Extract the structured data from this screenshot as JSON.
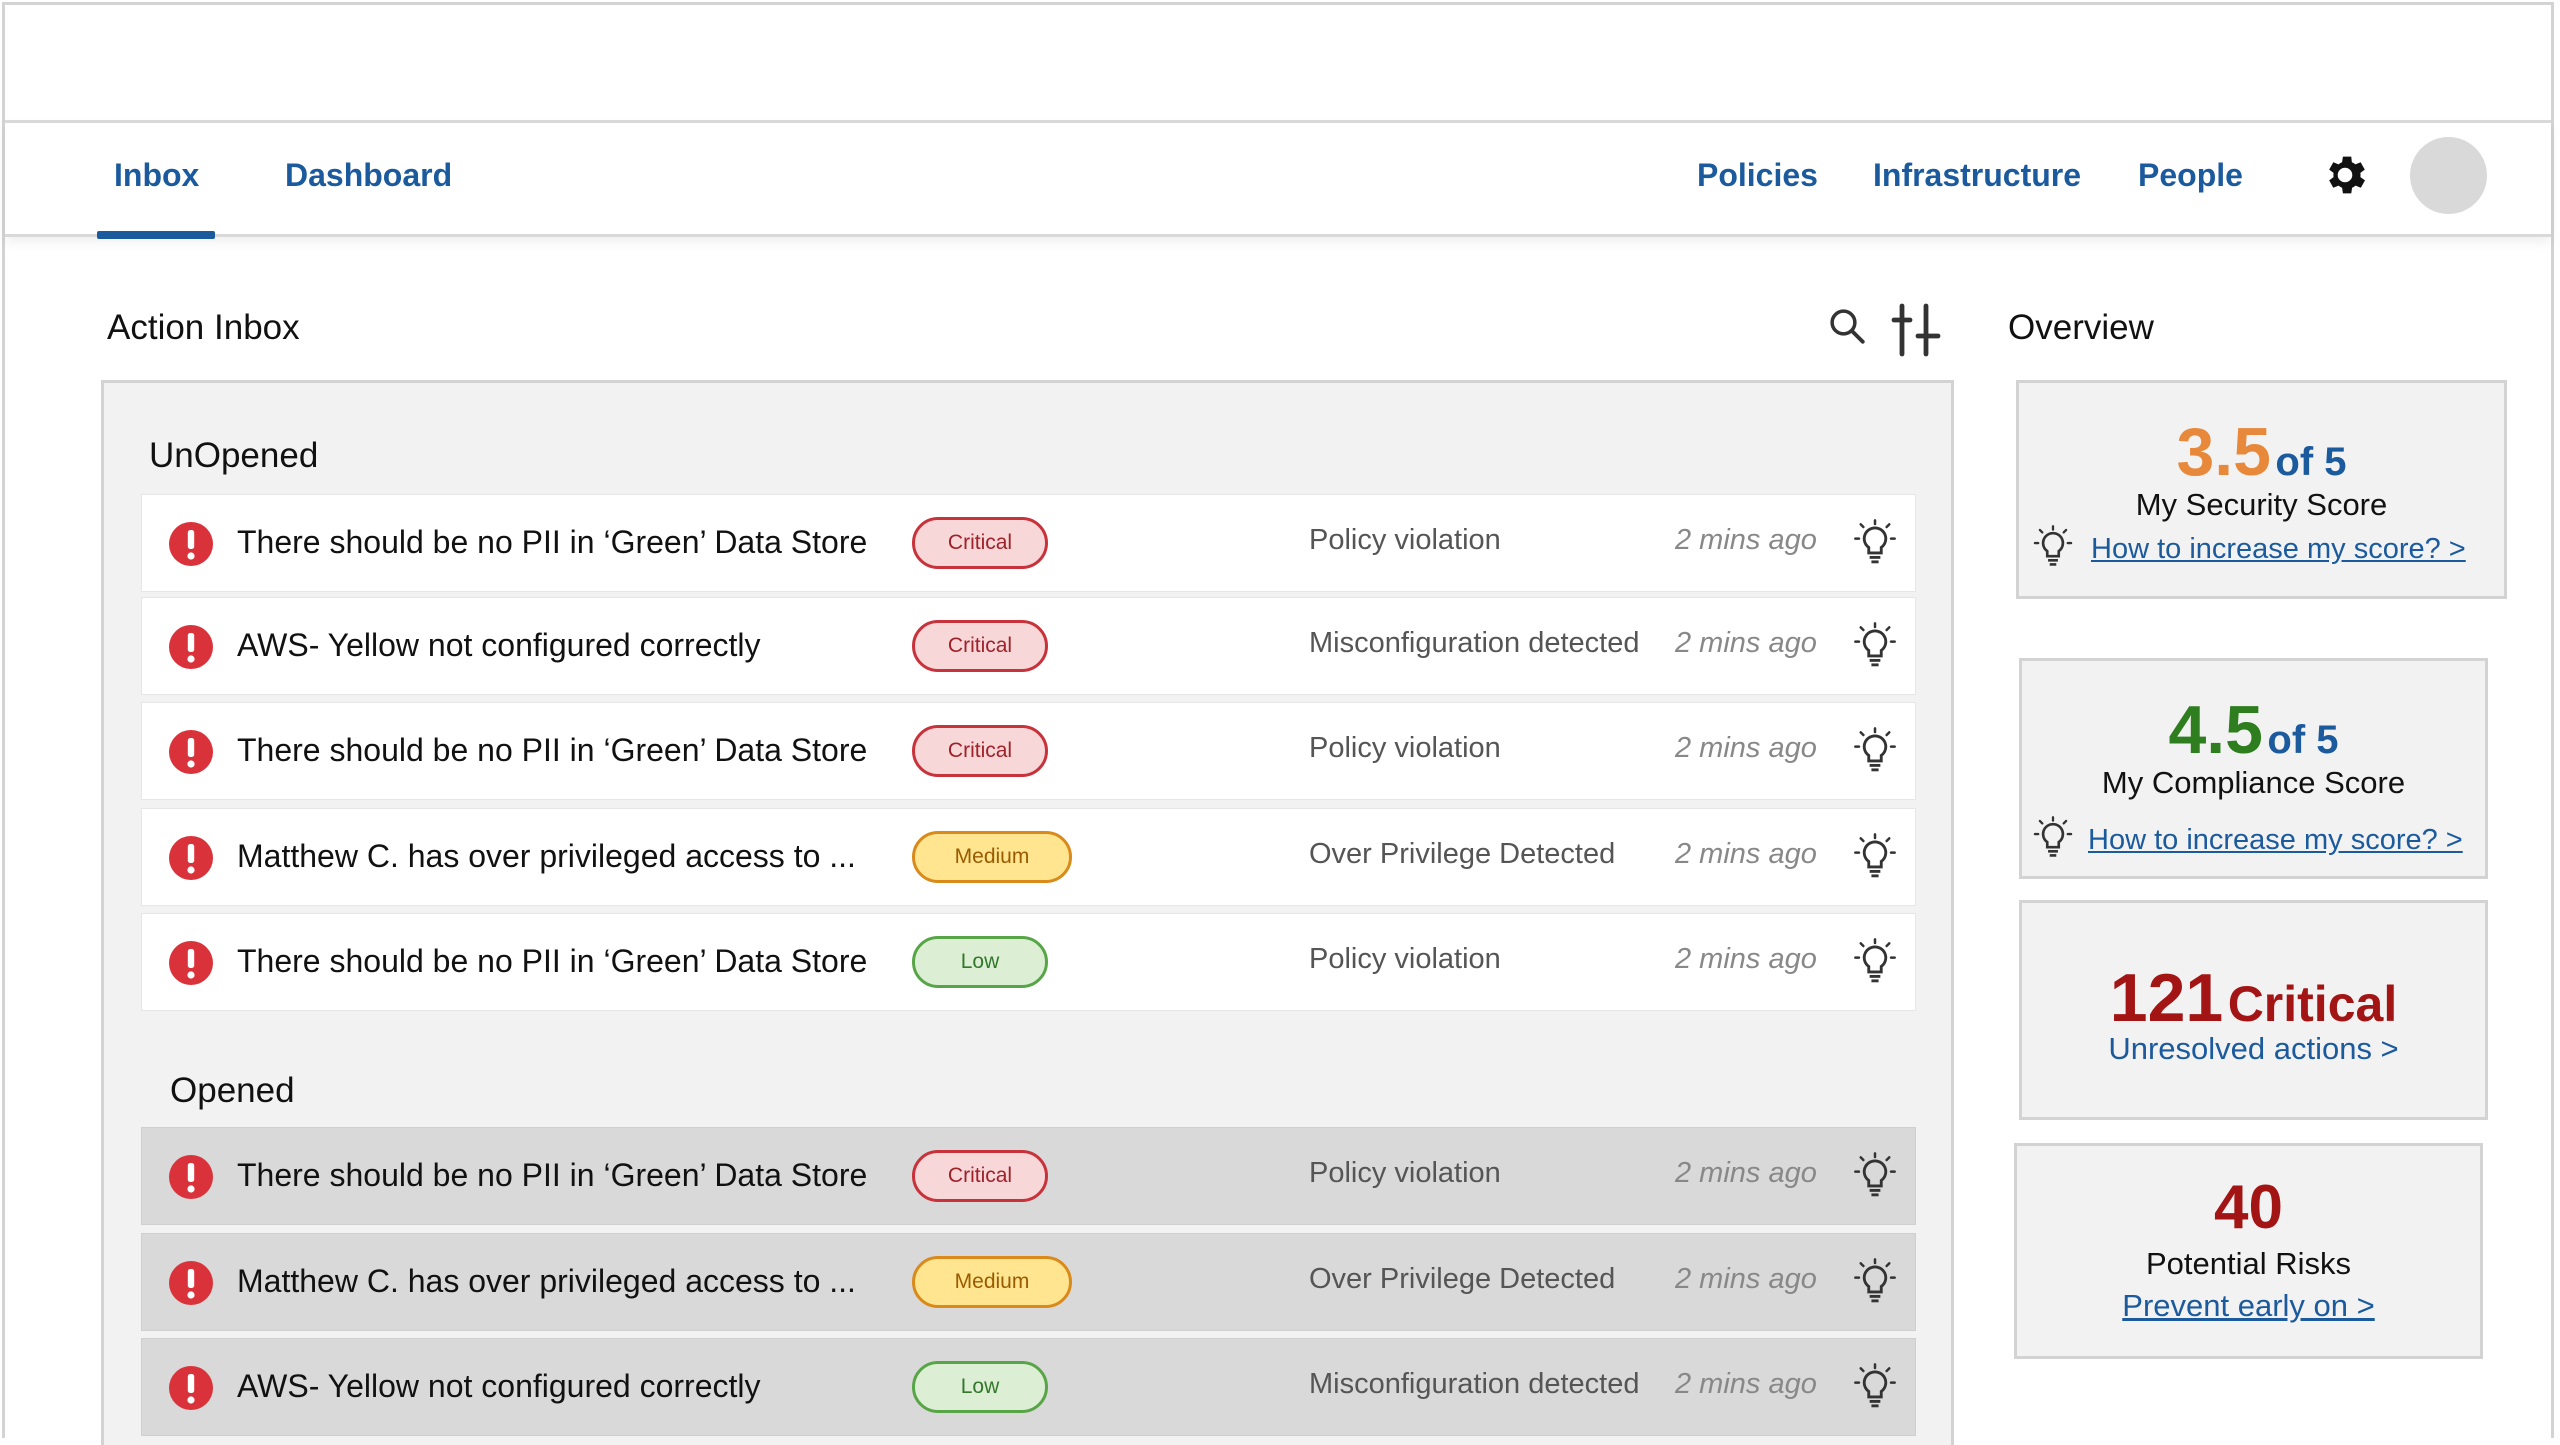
{
  "nav": {
    "left_tabs": [
      {
        "label": "Inbox",
        "active": true
      },
      {
        "label": "Dashboard",
        "active": false
      }
    ],
    "right_links": [
      "Policies",
      "Infrastructure",
      "People"
    ],
    "settings_icon": "gear-icon",
    "accent_color": "#1b5a9d"
  },
  "inbox": {
    "title": "Action Inbox",
    "toolbar_icons": [
      "search-icon",
      "filter-sliders-icon"
    ],
    "unopened_label": "UnOpened",
    "opened_label": "Opened",
    "unopened": [
      {
        "title": "There should be no PII in ‘Green’ Data Store",
        "severity": "Critical",
        "type": "Policy violation",
        "time": "2 mins ago"
      },
      {
        "title": "AWS- Yellow  not configured correctly",
        "severity": "Critical",
        "type": "Misconfiguration detected",
        "time": "2 mins ago"
      },
      {
        "title": "There should be no PII in ‘Green’ Data Store",
        "severity": "Critical",
        "type": "Policy violation",
        "time": "2 mins ago"
      },
      {
        "title": "Matthew C. has over privileged access to ...",
        "severity": "Medium",
        "type": "Over Privilege Detected",
        "time": "2 mins ago"
      },
      {
        "title": "There should be no PII in ‘Green’ Data Store",
        "severity": "Low",
        "type": "Policy violation",
        "time": "2 mins ago"
      }
    ],
    "opened": [
      {
        "title": "There should be no PII in ‘Green’ Data Store",
        "severity": "Critical",
        "type": "Policy violation",
        "time": "2 mins ago"
      },
      {
        "title": "Matthew C. has over privileged access to ...",
        "severity": "Medium",
        "type": "Over Privilege Detected",
        "time": "2 mins ago"
      },
      {
        "title": "AWS- Yellow  not configured correctly",
        "severity": "Low",
        "type": "Misconfiguration detected",
        "time": "2 mins ago"
      }
    ],
    "severity_colors": {
      "Critical": "#c7323b",
      "Medium": "#d98a1a",
      "Low": "#58a548"
    }
  },
  "overview": {
    "title": "Overview",
    "security": {
      "score": "3.5",
      "of": "of 5",
      "label": "My Security Score",
      "link": "How to increase my score? >",
      "score_color": "#e8883a"
    },
    "compliance": {
      "score": "4.5",
      "of": "of 5",
      "label": "My Compliance Score",
      "link": "How to increase my score? >",
      "score_color": "#2e7d1e"
    },
    "critical": {
      "count": "121",
      "word": "Critical",
      "link": "Unresolved actions >",
      "color": "#a31515"
    },
    "risks": {
      "count": "40",
      "label": "Potential Risks",
      "link": "Prevent early on >",
      "color": "#a31515"
    }
  }
}
